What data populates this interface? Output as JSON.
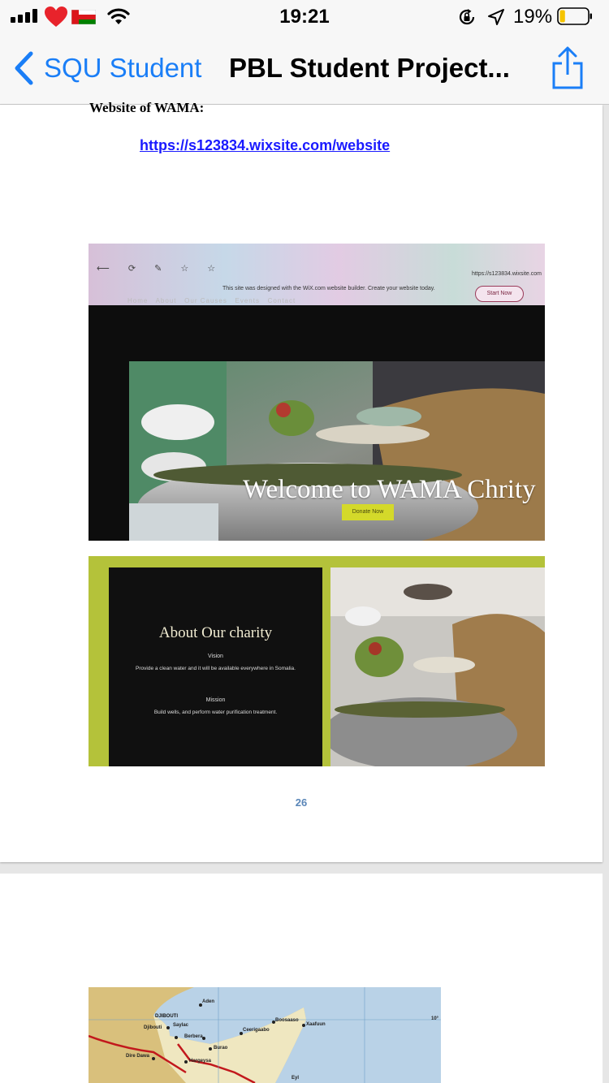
{
  "status_bar": {
    "time": "19:21",
    "battery_percent": "19%",
    "battery_level": 0.19,
    "icons": [
      "signal-bars-icon",
      "heart-icon",
      "oman-flag-icon",
      "wifi-icon",
      "orientation-lock-icon",
      "location-arrow-icon",
      "battery-icon"
    ]
  },
  "nav": {
    "back_label": "SQU Student",
    "title": "PBL Student Project...",
    "share_icon": "share-icon"
  },
  "document": {
    "page1": {
      "heading": "Website of WAMA:",
      "link": "https://s123834.wixsite.com/website",
      "page_number": "26",
      "screenshot1": {
        "browser_url": "https://s123834.wixsite.com",
        "wix_banner": "This site was designed with the WiX.com website builder. Create your website today.",
        "wix_button": "Start Now",
        "site_nav": [
          "Home",
          "About",
          "Our Causes",
          "Events",
          "Contact"
        ],
        "hero_title": "Welcome to WAMA Chrity",
        "donate_button": "Donate Now"
      },
      "screenshot2": {
        "about_title": "About Our charity",
        "vision_label": "Vision",
        "vision_text": "Provide a clean water and it will be available everywhere in Somalia.",
        "mission_label": "Mission",
        "mission_text": "Build wells, and perform water purification treatment."
      }
    },
    "page2": {
      "map_labels": [
        "Aden",
        "DJIBOUTI",
        "Djibouti",
        "Saylac",
        "Berbera",
        "Ceerigaabo",
        "Boosaaso",
        "Xaafuun",
        "Burao",
        "Dire Dawa",
        "Hargeysa",
        "10°",
        "Eyl"
      ]
    }
  }
}
